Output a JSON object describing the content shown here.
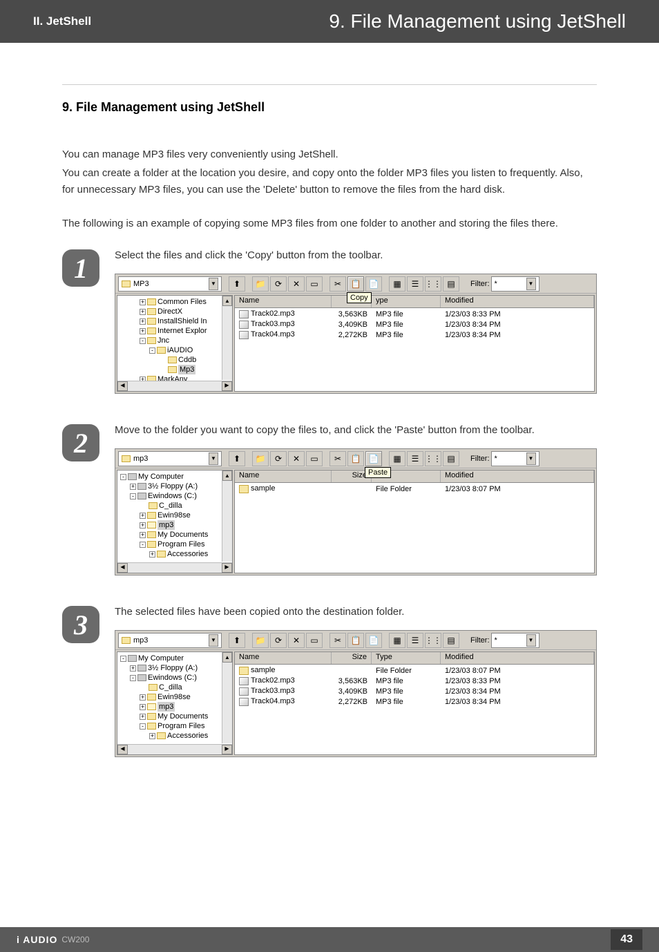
{
  "header": {
    "left": "II. JetShell",
    "right": "9. File Management using JetShell"
  },
  "title": "9. File Management using JetShell",
  "para1": "You can manage MP3 files very conveniently using JetShell.",
  "para2": "You can create a folder at the location you desire, and copy onto the folder MP3 files you listen to frequently. Also, for unnecessary MP3 files, you can use the 'Delete' button to remove the files from the hard disk.",
  "para3": "The following is an example of copying some MP3 files from one folder to another and storing the files there.",
  "steps": {
    "s1": {
      "num": "1",
      "text": "Select the files and click the 'Copy' button from the toolbar."
    },
    "s2": {
      "num": "2",
      "text": "Move to the folder you want to copy the files to, and click the 'Paste' button from the toolbar."
    },
    "s3": {
      "num": "3",
      "text": "The selected files have been copied onto the destination folder."
    }
  },
  "filter_label": "Filter:",
  "filter_value": "*",
  "cols": {
    "name": "Name",
    "size": "Size",
    "type": "Type",
    "type_partial": "ype",
    "modified": "Modified"
  },
  "tooltips": {
    "copy": "Copy",
    "paste": "Paste",
    "size_prefix": "Si"
  },
  "shot1": {
    "combo": "MP3",
    "tree": [
      {
        "indent": 30,
        "exp": "+",
        "label": "Common Files"
      },
      {
        "indent": 30,
        "exp": "+",
        "label": "DirectX"
      },
      {
        "indent": 30,
        "exp": "+",
        "label": "InstallShield In"
      },
      {
        "indent": 30,
        "exp": "+",
        "label": "Internet Explor"
      },
      {
        "indent": 30,
        "exp": "-",
        "label": "Jnc"
      },
      {
        "indent": 44,
        "exp": "-",
        "label": "iAUDIO"
      },
      {
        "indent": 58,
        "exp": "",
        "label": "Cddb"
      },
      {
        "indent": 58,
        "exp": "",
        "label": "Mp3",
        "sel": true
      },
      {
        "indent": 30,
        "exp": "+",
        "label": "MarkAny"
      }
    ],
    "rows": [
      {
        "name": "Track02.mp3",
        "size": "3,563KB",
        "type": "MP3 file",
        "mod": "1/23/03 8:33 PM"
      },
      {
        "name": "Track03.mp3",
        "size": "3,409KB",
        "type": "MP3 file",
        "mod": "1/23/03 8:34 PM"
      },
      {
        "name": "Track04.mp3",
        "size": "2,272KB",
        "type": "MP3 file",
        "mod": "1/23/03 8:34 PM"
      }
    ]
  },
  "shot2": {
    "combo": "mp3",
    "tree": [
      {
        "indent": 2,
        "exp": "-",
        "label": "My Computer",
        "drv": true
      },
      {
        "indent": 16,
        "exp": "+",
        "label": "3½ Floppy (A:)",
        "drv": true
      },
      {
        "indent": 16,
        "exp": "-",
        "label": "Ewindows (C:)",
        "drv": true
      },
      {
        "indent": 30,
        "exp": "",
        "label": "C_dilla"
      },
      {
        "indent": 30,
        "exp": "+",
        "label": "Ewin98se"
      },
      {
        "indent": 30,
        "exp": "+",
        "label": "mp3",
        "sel": true,
        "open": true
      },
      {
        "indent": 30,
        "exp": "+",
        "label": "My Documents"
      },
      {
        "indent": 30,
        "exp": "-",
        "label": "Program Files"
      },
      {
        "indent": 44,
        "exp": "+",
        "label": "Accessories"
      }
    ],
    "rows": [
      {
        "name": "sample",
        "size": "",
        "type": "File Folder",
        "mod": "1/23/03 8:07 PM",
        "folder": true
      }
    ]
  },
  "shot3": {
    "combo": "mp3",
    "tree": [
      {
        "indent": 2,
        "exp": "-",
        "label": "My Computer",
        "drv": true
      },
      {
        "indent": 16,
        "exp": "+",
        "label": "3½ Floppy (A:)",
        "drv": true
      },
      {
        "indent": 16,
        "exp": "-",
        "label": "Ewindows (C:)",
        "drv": true
      },
      {
        "indent": 30,
        "exp": "",
        "label": "C_dilla"
      },
      {
        "indent": 30,
        "exp": "+",
        "label": "Ewin98se"
      },
      {
        "indent": 30,
        "exp": "+",
        "label": "mp3",
        "sel": true,
        "open": true
      },
      {
        "indent": 30,
        "exp": "+",
        "label": "My Documents"
      },
      {
        "indent": 30,
        "exp": "-",
        "label": "Program Files"
      },
      {
        "indent": 44,
        "exp": "+",
        "label": "Accessories"
      }
    ],
    "rows": [
      {
        "name": "sample",
        "size": "",
        "type": "File Folder",
        "mod": "1/23/03 8:07 PM",
        "folder": true
      },
      {
        "name": "Track02.mp3",
        "size": "3,563KB",
        "type": "MP3 file",
        "mod": "1/23/03 8:33 PM"
      },
      {
        "name": "Track03.mp3",
        "size": "3,409KB",
        "type": "MP3 file",
        "mod": "1/23/03 8:34 PM"
      },
      {
        "name": "Track04.mp3",
        "size": "2,272KB",
        "type": "MP3 file",
        "mod": "1/23/03 8:34 PM"
      }
    ]
  },
  "footer": {
    "brand": "i AUDIO",
    "model": "CW200",
    "page": "43"
  }
}
